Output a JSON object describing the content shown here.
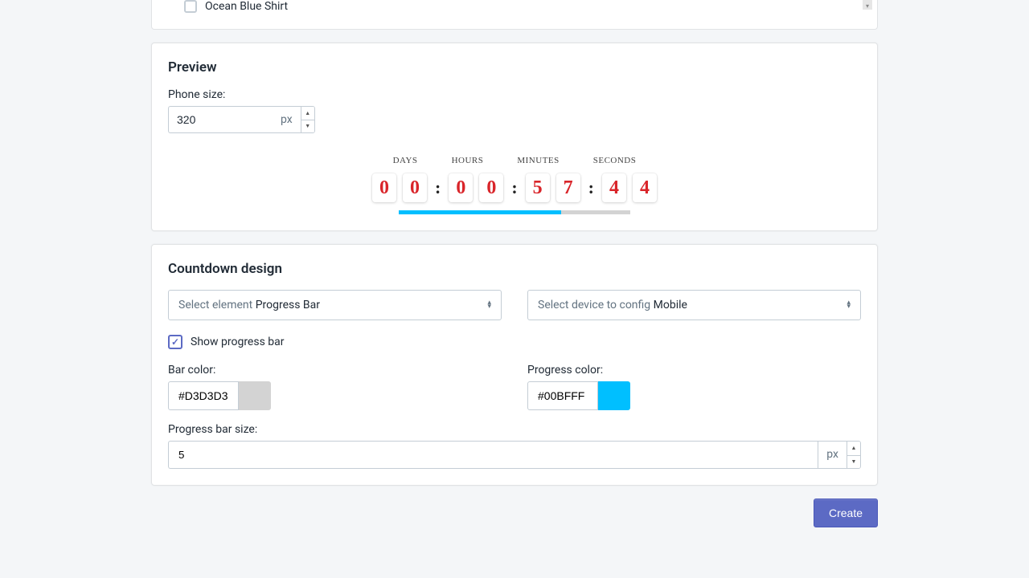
{
  "top_item": {
    "label": "Ocean Blue Shirt"
  },
  "preview": {
    "title": "Preview",
    "phone_size_label": "Phone size:",
    "phone_size_value": "320",
    "phone_size_unit": "px",
    "labels": {
      "days": "DAYS",
      "hours": "HOURS",
      "minutes": "MINUTES",
      "seconds": "SECONDS"
    },
    "digits": {
      "d1": "0",
      "d2": "0",
      "h1": "0",
      "h2": "0",
      "m1": "5",
      "m2": "7",
      "s1": "4",
      "s2": "4"
    }
  },
  "design": {
    "title": "Countdown design",
    "select_element_prefix": "Select element ",
    "select_element_value": "Progress Bar",
    "select_device_prefix": "Select device to config ",
    "select_device_value": "Mobile",
    "show_progress_label": "Show progress bar",
    "bar_color_label": "Bar color:",
    "bar_color_value": "#D3D3D3",
    "progress_color_label": "Progress color:",
    "progress_color_value": "#00BFFF",
    "progress_size_label": "Progress bar size:",
    "progress_size_value": "5",
    "progress_size_unit": "px"
  },
  "actions": {
    "create": "Create"
  },
  "colors": {
    "bar_swatch": "#D3D3D3",
    "progress_swatch": "#00BFFF"
  }
}
